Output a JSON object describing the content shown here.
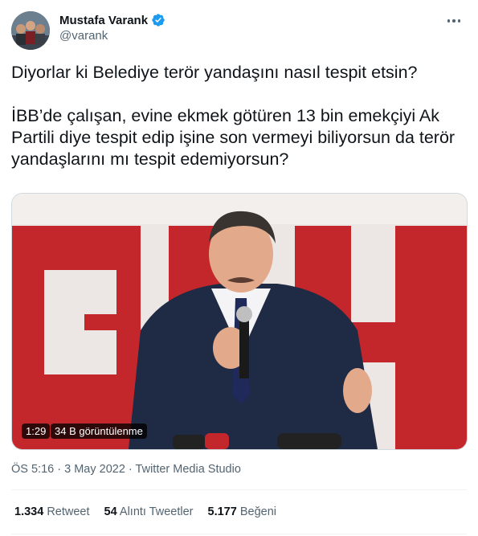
{
  "author": {
    "display_name": "Mustafa Varank",
    "handle": "@varank",
    "verified": true
  },
  "tweet": {
    "text": "Diyorlar ki Belediye terör yandaşını nasıl tespit etsin?\n\nİBB’de çalışan, evine ekmek götüren 13 bin emekçiyi Ak Partili diye tespit edip işine son vermeyi biliyorsun da terör yandaşlarını mı tespit edemiyorsun?"
  },
  "media": {
    "duration": "1:29",
    "views": "34 B görüntülenme"
  },
  "meta": {
    "time": "ÖS 5:16",
    "separator1": "·",
    "date": "3 May 2022",
    "separator2": "·",
    "source": "Twitter Media Studio"
  },
  "stats": {
    "retweets_count": "1.334",
    "retweets_label": "Retweet",
    "quotes_count": "54",
    "quotes_label": "Alıntı Tweetler",
    "likes_count": "5.177",
    "likes_label": "Beğeni"
  },
  "colors": {
    "verified_blue": "#1d9bf0",
    "secondary_text": "#536471",
    "primary_text": "#0f1419",
    "backdrop_red": "#c3272b"
  }
}
